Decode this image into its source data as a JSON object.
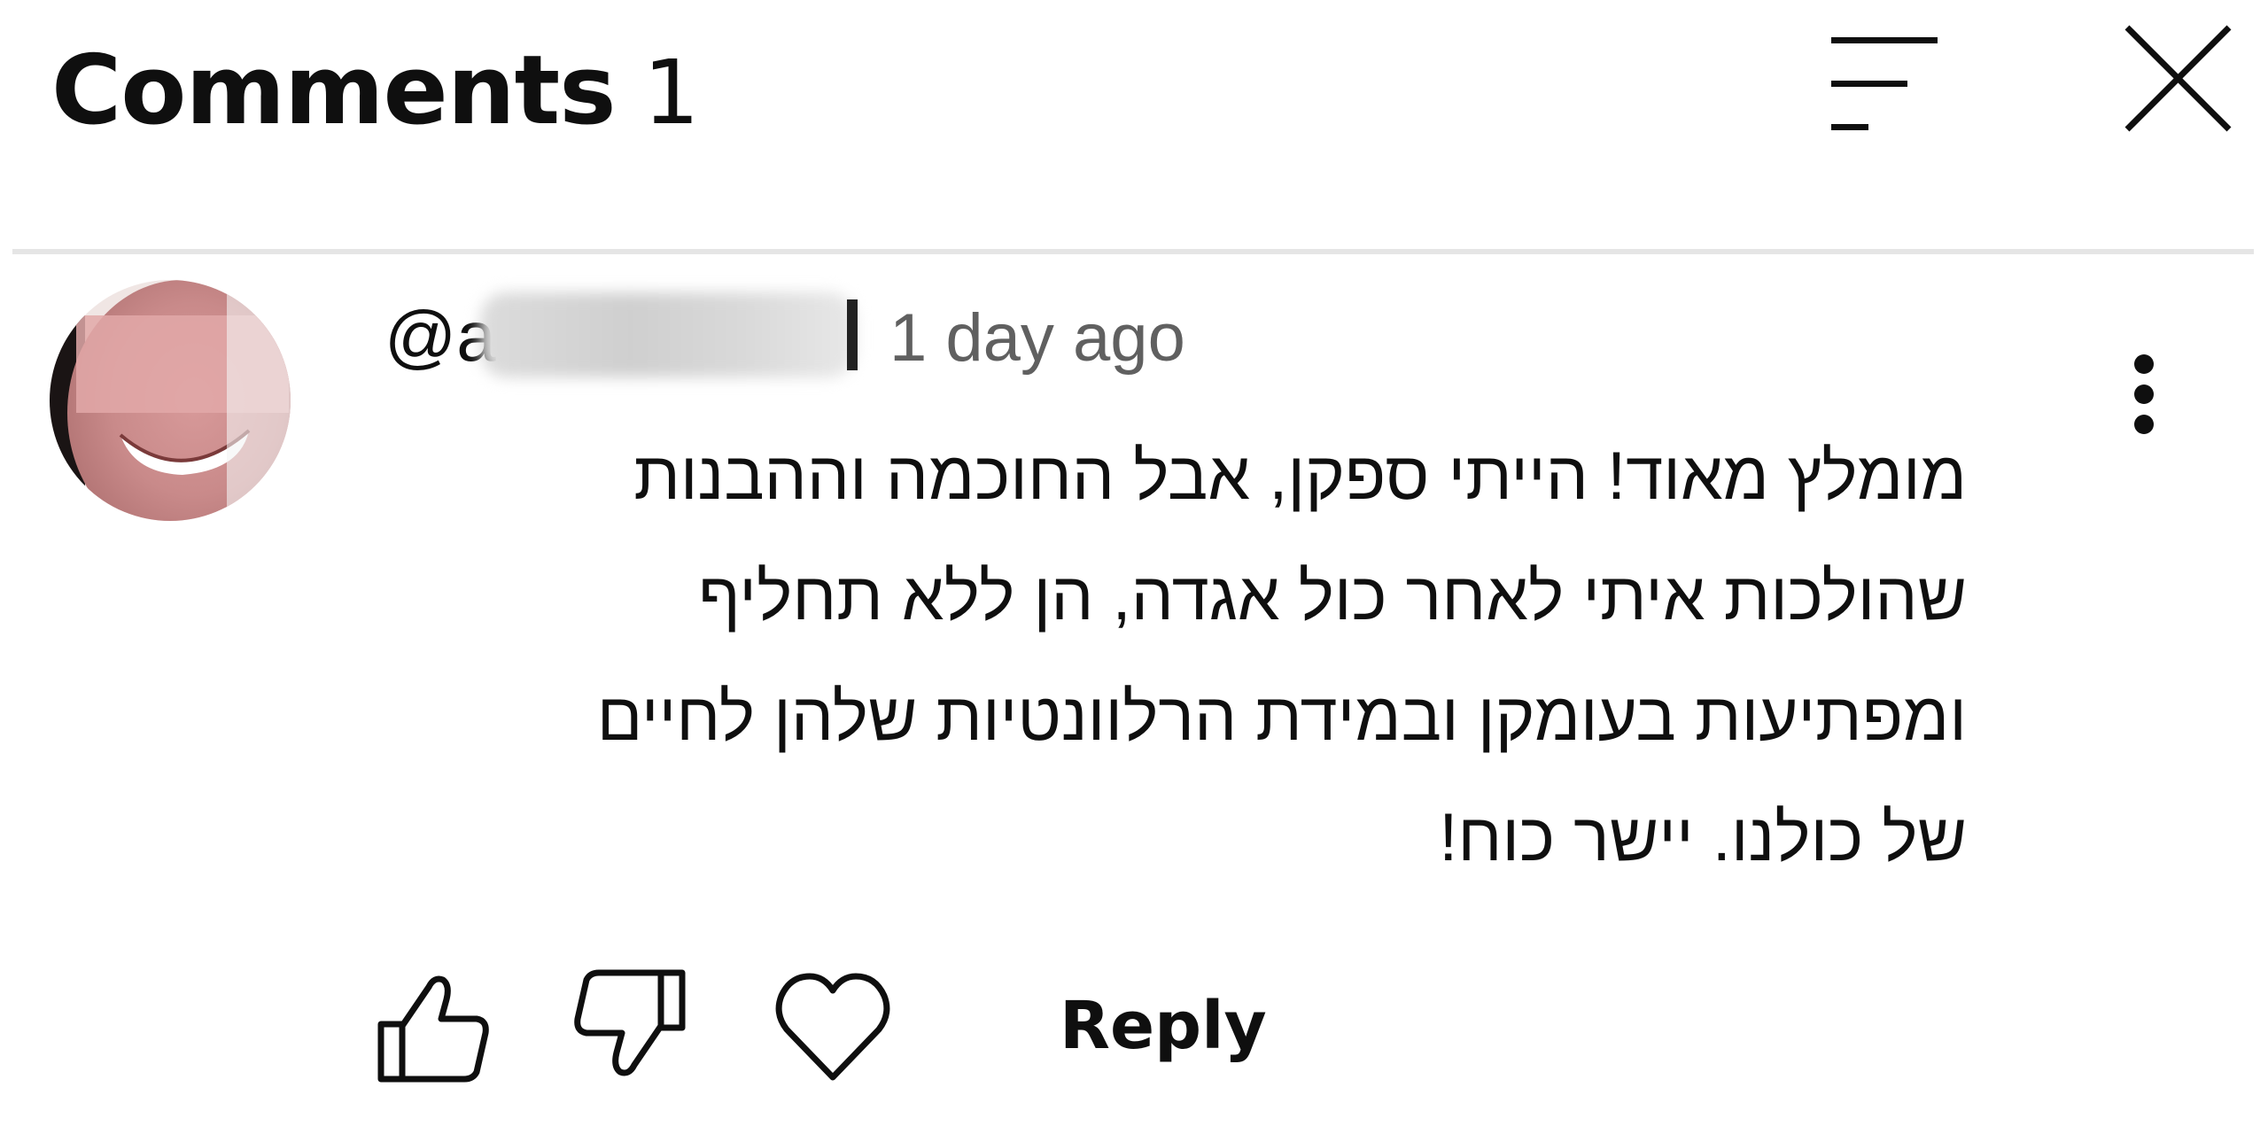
{
  "header": {
    "title": "Comments",
    "count": "1"
  },
  "comment": {
    "author_prefix": "@a",
    "timestamp": "1 day ago",
    "text_lines": [
      "מומלץ מאוד! הייתי ספקן, אבל החוכמה וההבנות",
      "שהולכות איתי לאחר כול אגדה, הן ללא תחליף",
      "ומפתיעות בעומקן ובמידת הרלוונטיות שלהן לחיים",
      "של כולנו. יישר כוח!"
    ],
    "reply_label": "Reply"
  },
  "icons": {
    "sort": "sort-icon",
    "close": "close-icon",
    "more": "more-vertical-icon",
    "like": "thumbs-up-icon",
    "dislike": "thumbs-down-icon",
    "heart": "heart-icon"
  },
  "colors": {
    "text": "#0f0f0f",
    "secondary_text": "#606060",
    "divider": "#e5e5e5"
  }
}
